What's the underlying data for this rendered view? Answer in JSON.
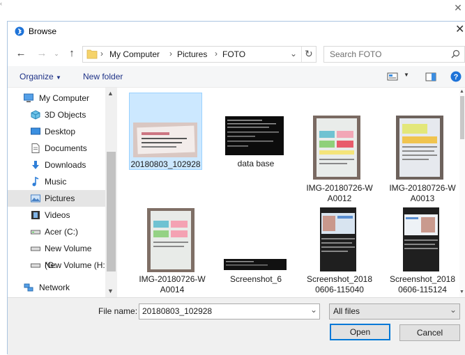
{
  "dialog": {
    "title": "Browse"
  },
  "address": {
    "breadcrumb": [
      "My Computer",
      "Pictures",
      "FOTO"
    ],
    "search_placeholder": "Search FOTO"
  },
  "toolbar": {
    "organize": "Organize",
    "new_folder": "New folder"
  },
  "nav": {
    "items": [
      {
        "label": "My Computer",
        "icon": "computer-icon"
      },
      {
        "label": "3D Objects",
        "icon": "cube-icon"
      },
      {
        "label": "Desktop",
        "icon": "desktop-icon"
      },
      {
        "label": "Documents",
        "icon": "document-icon"
      },
      {
        "label": "Downloads",
        "icon": "download-arrow-icon"
      },
      {
        "label": "Music",
        "icon": "music-note-icon"
      },
      {
        "label": "Pictures",
        "icon": "picture-icon",
        "selected": true
      },
      {
        "label": "Videos",
        "icon": "film-icon"
      },
      {
        "label": "Acer (C:)",
        "icon": "drive-icon"
      },
      {
        "label": "New Volume (G:",
        "icon": "drive-icon"
      },
      {
        "label": "New Volume (H:",
        "icon": "drive-icon"
      },
      {
        "label": "Network",
        "icon": "network-icon"
      }
    ]
  },
  "files": [
    {
      "line1": "20180803_102928",
      "line2": "",
      "selected": true
    },
    {
      "line1": "data base",
      "line2": ""
    },
    {
      "line1": "IMG-20180726-W",
      "line2": "A0012"
    },
    {
      "line1": "IMG-20180726-W",
      "line2": "A0013"
    },
    {
      "line1": "IMG-20180726-W",
      "line2": "A0014"
    },
    {
      "line1": "Screenshot_6",
      "line2": ""
    },
    {
      "line1": "Screenshot_2018",
      "line2": "0606-115040"
    },
    {
      "line1": "Screenshot_2018",
      "line2": "0606-115124"
    }
  ],
  "bottom": {
    "file_name_label": "File name:",
    "file_name_value": "20180803_102928",
    "file_type": "All files",
    "open": "Open",
    "cancel": "Cancel"
  },
  "colors": {
    "accent": "#0078d7",
    "selection": "#cce8ff",
    "nav_selected": "#e5e5e5"
  }
}
